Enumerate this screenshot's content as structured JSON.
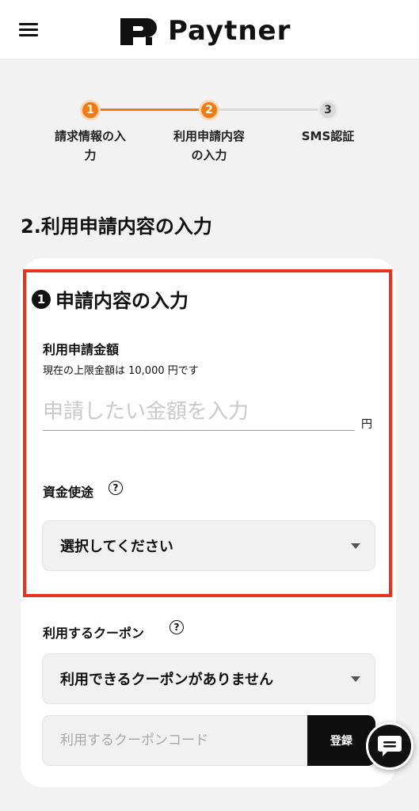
{
  "header": {
    "brand": "Paytner",
    "menu_icon": "hamburger-menu-icon",
    "logo_icon": "paytner-logo-mark"
  },
  "stepper": {
    "steps": [
      {
        "number": "1",
        "label_line1": "請求情報の入",
        "label_line2": "力",
        "state": "done"
      },
      {
        "number": "2",
        "label_line1": "利用申請内容",
        "label_line2": "の入力",
        "state": "current"
      },
      {
        "number": "3",
        "label_line1": "SMS認証",
        "label_line2": "",
        "state": "pending"
      }
    ],
    "colors": {
      "active": "#f07a14",
      "inactive": "#d9d9d9",
      "inactive_text": "#333333"
    }
  },
  "page": {
    "title": "2.利用申請内容の入力"
  },
  "form": {
    "section_number": "1",
    "section_title": "申請内容の入力",
    "amount": {
      "label": "利用申請金額",
      "limit_note": "現在の上限金額は 10,000 円です",
      "placeholder": "申請したい金額を入力",
      "unit": "円"
    },
    "purpose": {
      "label": "資金使途",
      "help_icon": "question-circle-icon",
      "selected": "選択してください"
    },
    "coupon": {
      "label": "利用するクーポン",
      "help_icon": "question-circle-icon",
      "selected": "利用できるクーポンがありません",
      "code_placeholder": "利用するクーポンコード",
      "register_label": "登録"
    }
  },
  "chat": {
    "icon": "chat-bubble-icon"
  },
  "colors": {
    "highlight_border": "#e8321e",
    "accent": "#f07a14",
    "button_bg": "#0f0f0f"
  }
}
